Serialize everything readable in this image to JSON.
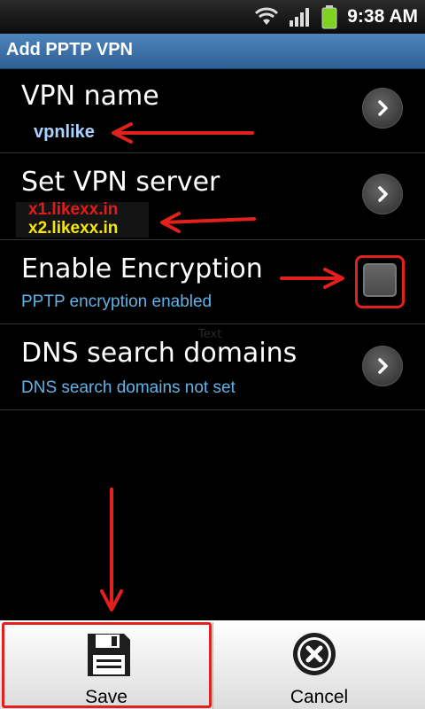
{
  "status_bar": {
    "time": "9:38 AM",
    "icons": [
      "wifi-icon",
      "signal-icon",
      "battery-icon"
    ]
  },
  "title_bar": {
    "title": "Add PPTP VPN"
  },
  "settings": [
    {
      "title": "VPN name",
      "value": "vpnlike"
    },
    {
      "title": "Set VPN server",
      "values": [
        "x1.likexx.in",
        "x2.likexx.in"
      ]
    },
    {
      "title": "Enable Encryption",
      "summary": "PPTP encryption enabled",
      "checked": false
    },
    {
      "title": "DNS search domains",
      "summary": "DNS search domains not set"
    }
  ],
  "buttons": {
    "save_label": "Save",
    "cancel_label": "Cancel"
  },
  "colors": {
    "title_bar": "#3a72aa",
    "summary_text": "#5fb3e8",
    "annotation_red": "#e2201c",
    "server_red": "#e21b1b",
    "server_yellow": "#f6e800"
  }
}
